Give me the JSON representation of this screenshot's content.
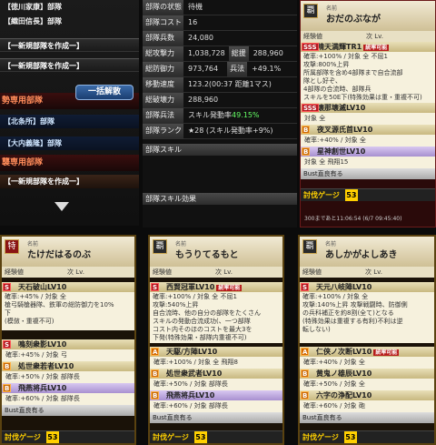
{
  "left_panel": {
    "rows": [
      "【徳川家康】部隊",
      "【織田信長】部隊",
      "【一新規部隊を作成一】",
      "【一新規部隊を作成一】"
    ],
    "section1": "勢専用部隊",
    "bulk_button": "一括解散",
    "deck1": "【北条所】部隊",
    "deck2": "【大内義隆】部隊",
    "section2": "襲専用部隊",
    "new_row3": "【一新規部隊を作成一】"
  },
  "stats": {
    "labels": [
      "部隊の状態",
      "部隊コスト",
      "部隊兵数",
      "総攻撃力",
      "総防御力",
      "移動速度",
      "総破壊力",
      "部隊兵法",
      "部隊ランク"
    ],
    "values": [
      "待機",
      "16",
      "24,080",
      "1,038,728",
      "973,764",
      "123.2(00:37 距離1マス)",
      "288,960",
      "スキル発動率",
      "★28 (スキル発動率+9%)"
    ],
    "attack_extra_label": "総援",
    "attack_extra_value": "288,960",
    "defense_extra_label": "兵法",
    "defense_extra_value": "+49.1%",
    "skill_rate": "49.15%",
    "skill_header": "部隊スキル",
    "effect_header": "部隊スキル効果"
  },
  "top_card": {
    "icon": "覇",
    "name_label": "名前",
    "name": "おだのぶなが",
    "exp_label": "経験値",
    "next_label": "次 Lv.",
    "next_value": "一",
    "skill_title": "晴天満輝TR1",
    "skill_tag": "統率可能",
    "skill_desc": [
      "確率:+100% / 対象 全 不屈1",
      "攻撃:800%上昇",
      "所属部隊を含め4部隊まで自合流部",
      "隊とし好ぞ、",
      "4部隊の合流時、部隊兵",
      "スキルを50E下(特殊効果は重・重複不可)"
    ],
    "sub_skills": [
      "壊那壊滅LV10",
      "夜叉源氏首LV10",
      "星神創世LV10"
    ],
    "sub_vals": [
      "対象 全 ",
      "確率:+40% / 対象 全",
      "対象 全 飛翔15"
    ],
    "flag": "Bust直良有る",
    "gauge_label": "討伐ゲージ",
    "gauge_value": "53",
    "footer": "300まであと11:06:54 (6/7 09:45:40)"
  },
  "cards": [
    {
      "icon": "特",
      "name_label": "名前",
      "name": "たけだはるのぶ",
      "exp_label": "経験値",
      "next_label": "次 Lv.",
      "skill1_grade": "S",
      "skill1_title": "天石破山LV10",
      "skill1_desc": [
        "確率:+45% / 対象 全",
        "槍弓騎槍器隊、鉄軍の総防御力を10%",
        "下",
        "(模倣・重複不可)"
      ],
      "skill2_grade": "S",
      "skill2_title": "鳴刻衆影LV10",
      "skill2_val": "確率:+45% / 対象 弓",
      "skill3_grade": "B",
      "skill3_title": "処世衆若者LV10",
      "skill3_val": "確率:+50% / 対象 部隊長",
      "skill4_grade": "B",
      "skill4_title": "飛燕将兵LV10",
      "skill4_val": "確率:+60% / 対象 部隊長",
      "flag": "Bust直良有る",
      "gauge_label": "討伐ゲージ",
      "gauge_value": "53"
    },
    {
      "icon": "覇",
      "name_label": "名前",
      "name": "もうりてるもと",
      "exp_label": "経験値",
      "next_label": "次 Lv.",
      "skill1_grade": "S",
      "skill1_title": "西賢冠軍LV10",
      "skill1_tag": "統率可能",
      "skill1_desc": [
        "確率:+100% / 対象 全 不屈1",
        "攻撃:540%上昇",
        "自合流時、他の自分の部隊をたくさん",
        "スキルの発動合流成功(、一つ部隊",
        "コスト内そのほのコストを最大3を",
        "下発(特殊効果・部隊内重複不可)"
      ],
      "skill2_grade": "A",
      "skill2_title": "天駆/方陣LV10",
      "skill2_val": "確率:+100% / 対象 全 飛翔8",
      "skill3_grade": "B",
      "skill3_title": "処世衆武者LV10",
      "skill3_val": "確率:+50% / 対象 部隊長",
      "skill4_grade": "B",
      "skill4_title": "飛燕将兵LV10",
      "skill4_val": "確率:+60% / 対象 部隊長",
      "flag": "Bust直良有る",
      "gauge_label": "討伐ゲージ",
      "gauge_value": "53"
    },
    {
      "icon": "覇",
      "name_label": "名前",
      "name": "あしかがよしあき",
      "exp_label": "経験値",
      "next_label": "次 Lv.",
      "skill1_grade": "S",
      "skill1_title": "天元八岐陣LV10",
      "skill1_desc": [
        "確率:+100% / 対象 全",
        "攻撃:140%上昇 攻撃戦闘時、防御側",
        "の兵科補正を約8割(全て)となる",
        "(特殊効果は重複する有利)不利は逆",
        "転しない)"
      ],
      "skill2_grade": "A",
      "skill2_title": "仁侠ノ次断LV10",
      "skill2_tag": "統率可能",
      "skill2_val": "確率:+40% / 対象 全",
      "skill3_grade": "B",
      "skill3_title": "黄鬼ノ雄辰LV10",
      "skill3_val": "確率:+50% / 対象 全",
      "skill4_grade": "B",
      "skill4_title": "六字の浄配LV10",
      "skill4_val": "確率:+60% / 対象 砲",
      "flag": "Bust直良有る",
      "gauge_label": "討伐ゲージ",
      "gauge_value": "53"
    }
  ]
}
